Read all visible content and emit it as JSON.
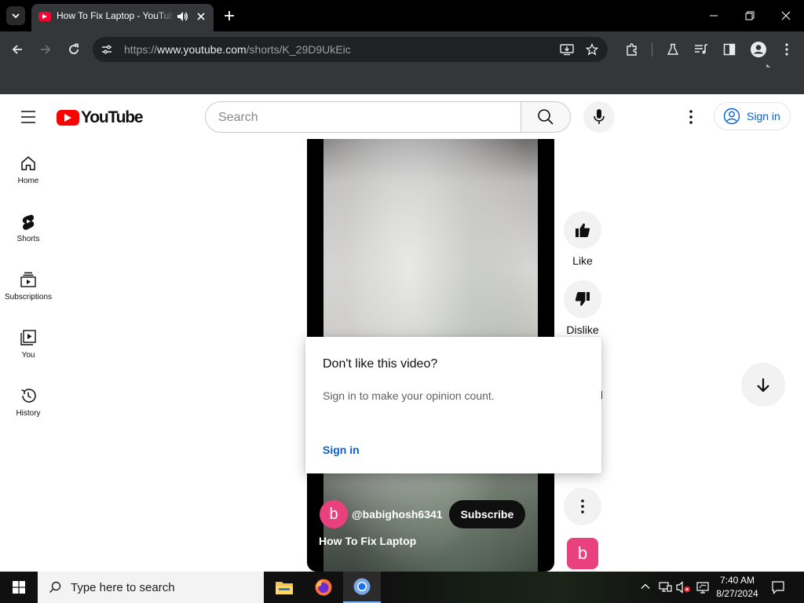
{
  "browser": {
    "tab_title": "How To Fix Laptop - YouTube",
    "url_prefix": "https://",
    "url_host": "www.youtube.com",
    "url_path": "/shorts/K_29D9UkEic"
  },
  "youtube": {
    "logo_text": "YouTube",
    "search_placeholder": "Search",
    "sign_in_label": "Sign in",
    "guide": [
      {
        "label": "Home",
        "icon": "home-icon"
      },
      {
        "label": "Shorts",
        "icon": "shorts-icon"
      },
      {
        "label": "Subscriptions",
        "icon": "subscriptions-icon"
      },
      {
        "label": "You",
        "icon": "you-icon"
      },
      {
        "label": "History",
        "icon": "history-icon"
      }
    ],
    "short": {
      "channel_initial": "b",
      "channel_handle": "@babighosh6341",
      "subscribe_label": "Subscribe",
      "title": "How To Fix Laptop"
    },
    "actions": {
      "like_label": "Like",
      "dislike_label": "Dislike"
    },
    "popup": {
      "title": "Don't like this video?",
      "body": "Sign in to make your opinion count.",
      "link": "Sign in"
    },
    "mini_avatar_initial": "b"
  },
  "taskbar": {
    "search_placeholder": "Type here to search",
    "time": "7:40 AM",
    "date": "8/27/2024"
  },
  "colors": {
    "yt_red": "#ff0000",
    "link_blue": "#065fd4",
    "avatar_pink": "#e8417d"
  }
}
